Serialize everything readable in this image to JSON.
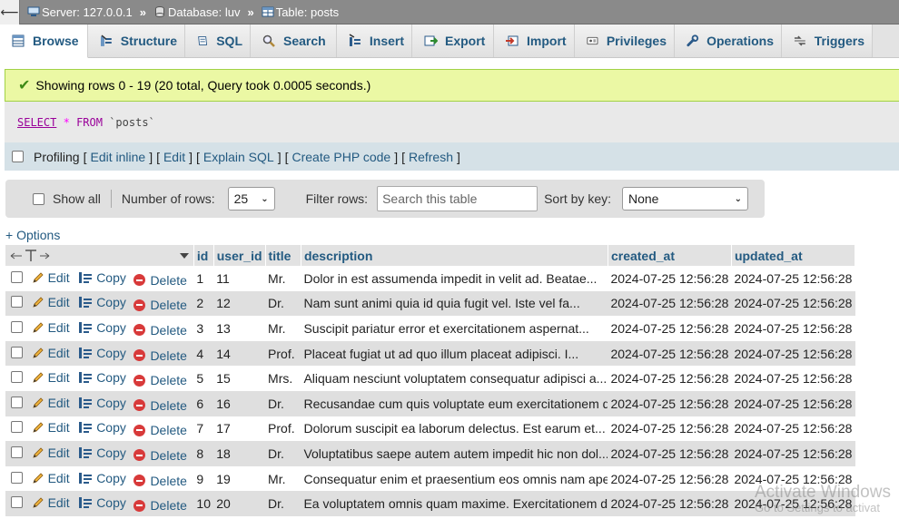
{
  "breadcrumb": {
    "back_glyph": "⟵",
    "server": "Server: 127.0.0.1",
    "database": "Database: luv",
    "table": "Table: posts",
    "separator": "»"
  },
  "tabs": [
    {
      "label": "Browse",
      "icon": "browse-icon",
      "active": true
    },
    {
      "label": "Structure",
      "icon": "structure-icon",
      "active": false
    },
    {
      "label": "SQL",
      "icon": "sql-icon",
      "active": false
    },
    {
      "label": "Search",
      "icon": "search-icon",
      "active": false
    },
    {
      "label": "Insert",
      "icon": "insert-icon",
      "active": false
    },
    {
      "label": "Export",
      "icon": "export-icon",
      "active": false
    },
    {
      "label": "Import",
      "icon": "import-icon",
      "active": false
    },
    {
      "label": "Privileges",
      "icon": "privileges-icon",
      "active": false
    },
    {
      "label": "Operations",
      "icon": "operations-icon",
      "active": false
    },
    {
      "label": "Triggers",
      "icon": "triggers-icon",
      "active": false
    }
  ],
  "message": {
    "text": "Showing rows 0 - 19 (20 total, Query took 0.0005 seconds.)"
  },
  "sql": {
    "select": "SELECT",
    "star": "*",
    "from": "FROM",
    "table": "`posts`"
  },
  "profiling": {
    "label": "Profiling",
    "open": "[",
    "close": "]",
    "links": [
      "Edit inline",
      "Edit",
      "Explain SQL",
      "Create PHP code",
      "Refresh"
    ]
  },
  "navbar": {
    "show_all": "Show all",
    "rows_label": "Number of rows:",
    "rows_value": "25",
    "filter_label": "Filter rows:",
    "filter_placeholder": "Search this table",
    "sort_label": "Sort by key:",
    "sort_value": "None"
  },
  "options_link": "+ Options",
  "table": {
    "columns": [
      "id",
      "user_id",
      "title",
      "description",
      "created_at",
      "updated_at"
    ],
    "actions": {
      "edit": "Edit",
      "copy": "Copy",
      "delete": "Delete"
    },
    "rows": [
      {
        "id": "1",
        "user_id": "11",
        "title": "Mr.",
        "description": "Dolor in est assumenda impedit in velit ad. Beatae...",
        "created_at": "2024-07-25 12:56:28",
        "updated_at": "2024-07-25 12:56:28"
      },
      {
        "id": "2",
        "user_id": "12",
        "title": "Dr.",
        "description": "Nam sunt animi quia id quia fugit vel. Iste vel fa...",
        "created_at": "2024-07-25 12:56:28",
        "updated_at": "2024-07-25 12:56:28"
      },
      {
        "id": "3",
        "user_id": "13",
        "title": "Mr.",
        "description": "Suscipit pariatur error et exercitationem aspernat...",
        "created_at": "2024-07-25 12:56:28",
        "updated_at": "2024-07-25 12:56:28"
      },
      {
        "id": "4",
        "user_id": "14",
        "title": "Prof.",
        "description": "Placeat fugiat ut ad quo illum placeat adipisci. I...",
        "created_at": "2024-07-25 12:56:28",
        "updated_at": "2024-07-25 12:56:28"
      },
      {
        "id": "5",
        "user_id": "15",
        "title": "Mrs.",
        "description": "Aliquam nesciunt voluptatem consequatur adipisci a...",
        "created_at": "2024-07-25 12:56:28",
        "updated_at": "2024-07-25 12:56:28"
      },
      {
        "id": "6",
        "user_id": "16",
        "title": "Dr.",
        "description": "Recusandae cum quis voluptate eum exercitationem q...",
        "created_at": "2024-07-25 12:56:28",
        "updated_at": "2024-07-25 12:56:28"
      },
      {
        "id": "7",
        "user_id": "17",
        "title": "Prof.",
        "description": "Dolorum suscipit ea laborum delectus. Est earum et...",
        "created_at": "2024-07-25 12:56:28",
        "updated_at": "2024-07-25 12:56:28"
      },
      {
        "id": "8",
        "user_id": "18",
        "title": "Dr.",
        "description": "Voluptatibus saepe autem autem impedit hic non dol...",
        "created_at": "2024-07-25 12:56:28",
        "updated_at": "2024-07-25 12:56:28"
      },
      {
        "id": "9",
        "user_id": "19",
        "title": "Mr.",
        "description": "Consequatur enim et praesentium eos omnis nam aper...",
        "created_at": "2024-07-25 12:56:28",
        "updated_at": "2024-07-25 12:56:28"
      },
      {
        "id": "10",
        "user_id": "20",
        "title": "Dr.",
        "description": "Ea voluptatem omnis quam maxime. Exercitationem di...",
        "created_at": "2024-07-25 12:56:28",
        "updated_at": "2024-07-25 12:56:28"
      }
    ]
  },
  "watermark": {
    "line1": "Activate Windows",
    "line2": "Go to Settings to activat"
  }
}
